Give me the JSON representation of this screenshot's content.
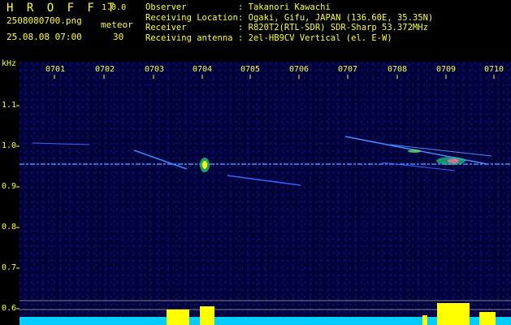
{
  "header": {
    "app_title": "H R O F F T",
    "version": "1.0.0",
    "filename": "2508080700.png",
    "datetime": "25.08.08 07:00",
    "meteor_label": "meteor",
    "meteor_count": "30",
    "meta": [
      {
        "key": "Observer",
        "value": ": Takanori Kawachi"
      },
      {
        "key": "Receiving Location",
        "value": ": Ogaki, Gifu, JAPAN (136.60E, 35.35N)"
      },
      {
        "key": "Receiver",
        "value": ": R820T2(RTL-SDR) SDR-Sharp 53.372MHz"
      },
      {
        "key": "Receiving antenna",
        "value": ": 2el-HB9CV Vertical (el. E-W)"
      }
    ]
  },
  "axes": {
    "y_unit": "kHz",
    "y_ticks": [
      "1.1",
      "1.0",
      "0.9",
      "0.8",
      "0.7",
      "0.6"
    ],
    "x_ticks": [
      "0701",
      "0702",
      "0703",
      "0704",
      "0705",
      "0706",
      "0707",
      "0708",
      "0709",
      "0710"
    ]
  },
  "colors": {
    "background": "#000000",
    "plot_bg": "#00003a",
    "text": "#ffff33",
    "carrier": "#33aaff",
    "meteor_hot": "#ffff00",
    "spectrum_fill": "#00ccff",
    "spectrum_peak": "#ffff00"
  }
}
